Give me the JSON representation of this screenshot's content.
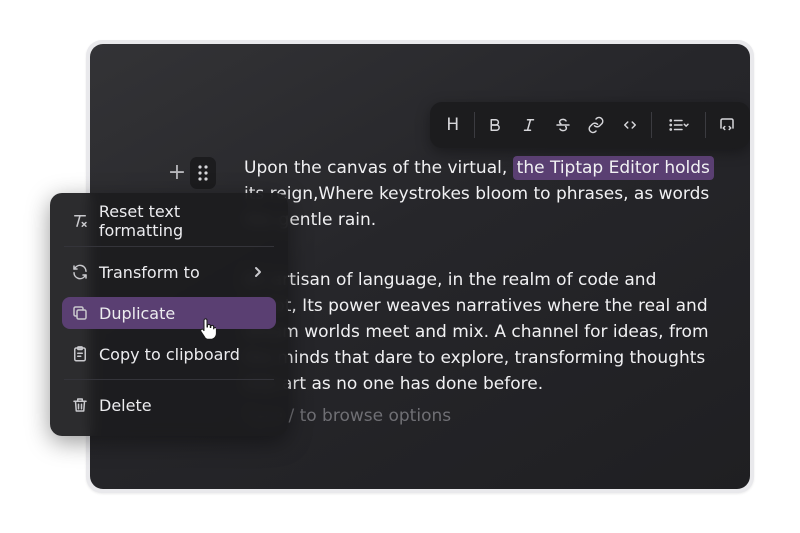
{
  "toolbar": {
    "heading_label": "H",
    "buttons": [
      "heading-icon",
      "bold-icon",
      "italic-icon",
      "strikethrough-icon",
      "link-icon",
      "code-icon",
      "bullet-list-icon",
      "code-block-icon"
    ]
  },
  "handle": {
    "plus_label": "+"
  },
  "content": {
    "p1_lead": "Upon the canvas of the virtual, ",
    "p1_highlight": "the Tiptap Editor holds",
    "p1_rest": "its reign,Where keystrokes bloom to phrases, as words like gentle rain.",
    "p2": "An artisan of language, in the realm of code and script, Its power weaves narratives where the real and dream worlds meet and mix. A channel for ideas, from the minds that dare to explore, transforming thoughts into art as no one has done before.",
    "placeholder": "Type / to browse options"
  },
  "menu": {
    "reset": "Reset text formatting",
    "transform": "Transform to",
    "duplicate": "Duplicate",
    "copy": "Copy to clipboard",
    "delete": "Delete"
  },
  "colors": {
    "accent": "#5a3f72",
    "editor_bg": "#2a2a2e",
    "toolbar_bg": "#1c1c1e"
  }
}
